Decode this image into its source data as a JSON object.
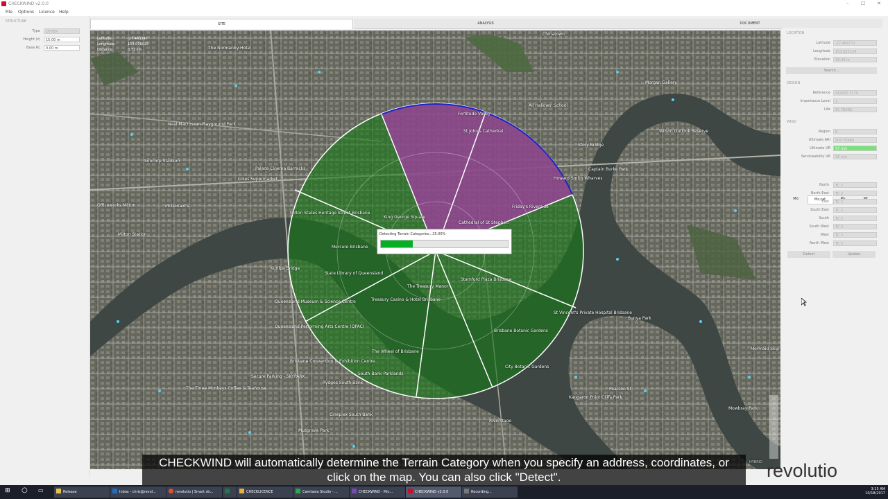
{
  "window": {
    "title": "CHECKWIND v2.0.0",
    "minimize": "–",
    "maximize": "☐",
    "close": "✕"
  },
  "menu": [
    "File",
    "Options",
    "Licence",
    "Help"
  ],
  "structure": {
    "section": "STRUCTURE",
    "type_label": "Type",
    "type_value": "OTHER",
    "height_label": "Height (z)",
    "height_value": "15.00 m",
    "base_label": "Base RL",
    "base_value": "0.00 m"
  },
  "tabs": [
    "SITE",
    "ANALYSIS",
    "DOCUMENT"
  ],
  "map": {
    "latitude_label": "Latitude:",
    "latitude_value": "-27.463347",
    "longitude_label": "Longitude:",
    "longitude_value": "153.016025",
    "distance_label": "Distance:",
    "distance_value": "0.72 km",
    "labels": [
      "Chinatown",
      "The Normanby Hotel",
      "Neal Macrossan Playground Park",
      "Suncorp Stadium",
      "Palace Cinema Barracks",
      "Coles Supermarket",
      "Officeworks Milton",
      "McDonald's",
      "Milton Station",
      "Milton States Heritage Street Brisbane",
      "Mercure Brisbane",
      "Kurilpa Bridge",
      "State Library of Queensland",
      "Queensland Museum & Science Centre",
      "Queensland Performing Arts Centre (QPAC)",
      "Brisbane Convention & Exhibition Centre",
      "Secure Parking - SKYPARK",
      "The Three Monkeys Coffee & Teahouse",
      "Musgrave Park",
      "Cineplex South Bank",
      "The Wheel of Brisbane",
      "South Bank Parklands",
      "Rydges South Bank",
      "King George Square",
      "Treasury Casino & Hotel Brisbane",
      "The Treasury Manor",
      "Stamford Plaza Brisbane",
      "Brisbane Botanic Gardens",
      "Kangaroo Point Cliffs Park",
      "Riverstage",
      "City Botanic Gardens",
      "Story Bridge",
      "Captain Burke Park",
      "Wilson Outlook Reserve",
      "Howard Smith Wharves",
      "St Vincent's Private Hospital Brisbane",
      "Mowbray Park",
      "Pearson St",
      "Bunya Park",
      "Mermaid Skip",
      "Cathedral of St Stephen",
      "Friday's Riverside",
      "St John's Cathedral",
      "All Hallows' School",
      "Fortitude Valley",
      "Morgan Gallery"
    ]
  },
  "progress": {
    "text": "Detecting Terrain Categories...25.00%",
    "percent": 25
  },
  "location": {
    "section": "LOCATION",
    "lat_label": "Latitude",
    "lat_value": "-27.469771",
    "lon_label": "Longitude",
    "lon_value": "153.025124",
    "elev_label": "Elevation",
    "elev_value": "28.04 m",
    "search_label": "Search..."
  },
  "design": {
    "section": "DESIGN",
    "ref_label": "Reference",
    "ref_value": "AS/NZS 1170",
    "imp_label": "Importance Level",
    "imp_value": "2",
    "life_label": "Life",
    "life_value": "50 YEARS"
  },
  "wind": {
    "section": "WIND",
    "region_label": "Region",
    "region_value": "B",
    "arl_label": "Ultimate ARI",
    "arl_value": "500 YEARS",
    "vr_label": "Ultimate VR",
    "vr_value": "57 m/s",
    "svc_label": "Serviceability VR",
    "svc_value": "26 m/s"
  },
  "mtabs": [
    "Md",
    "Mz,cat",
    "Ms",
    "Mt"
  ],
  "directions": [
    {
      "label": "North",
      "value": "TC 2"
    },
    {
      "label": "North East",
      "value": "TC 2"
    },
    {
      "label": "East",
      "value": "TC 2"
    },
    {
      "label": "South East",
      "value": "TC 2"
    },
    {
      "label": "South",
      "value": "TC 2"
    },
    {
      "label": "South West",
      "value": "TC 2"
    },
    {
      "label": "West",
      "value": "TC 2"
    },
    {
      "label": "North West",
      "value": "TC 2"
    }
  ],
  "buttons": {
    "detect": "Detect",
    "update": "Update",
    "hybrid": "HYBRID"
  },
  "subtitle": {
    "line1": "CHECKWIND will automatically determine the Terrain Category when you specify an address, coordinates, or",
    "line2": "click on the map. You can also click \"Detect\"."
  },
  "logo": {
    "text_pre": "revolutio",
    "text_post": ""
  },
  "taskbar": {
    "items": [
      "Release",
      "Inbox - chris@revol...",
      "revolutio | Smart str...",
      "",
      "CHECKLICENCE",
      "Camtasia Studio - ...",
      "CHECKWIND - Mic...",
      "CHECKWIND v2.0.0",
      "Recording..."
    ],
    "time": "3:15 AM",
    "date": "10/18/2017"
  },
  "colors": {
    "accent_red": "#c8102e",
    "progress_green": "#06b025",
    "sector_green": "#1e8a1e",
    "sector_purple": "#9a2a9c"
  }
}
